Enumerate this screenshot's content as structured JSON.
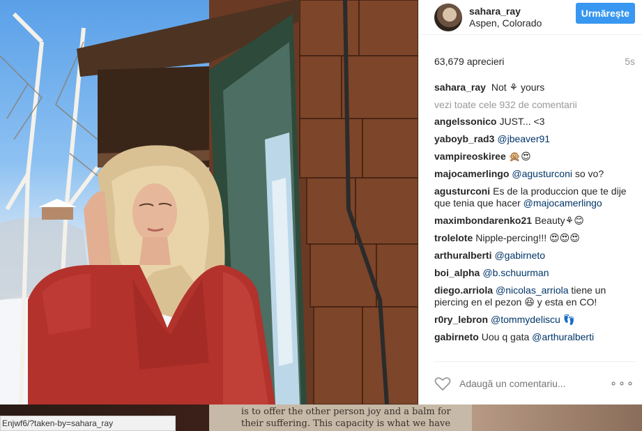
{
  "post": {
    "username": "sahara_ray",
    "location": "Aspen, Colorado",
    "follow_label": "Urmărește",
    "likes": "63,679 aprecieri",
    "time": "5s",
    "caption_user": "sahara_ray",
    "caption_text": "Not ⚘ yours",
    "view_all": "vezi toate cele 932 de comentarii",
    "comments": [
      {
        "user": "angelssonico",
        "text": "JUST... <3",
        "mention": ""
      },
      {
        "user": "yaboyb_rad3",
        "text": "",
        "mention": "@jbeaver91"
      },
      {
        "user": "vampireoskiree",
        "text": "🙊😍",
        "mention": ""
      },
      {
        "user": "majocamerlingo",
        "text": " so vo?",
        "mention": "@agusturconi"
      },
      {
        "user": "agusturconi",
        "text": "Es de la produccion que te dije que tenia que hacer ",
        "mention": "@majocamerlingo"
      },
      {
        "user": "maximbondarenko21",
        "text": "Beauty⚘😊",
        "mention": ""
      },
      {
        "user": "trolelote",
        "text": "Nipple-percing!!! 😍😍😍",
        "mention": ""
      },
      {
        "user": "arthuralberti",
        "text": "",
        "mention": "@gabirneto"
      },
      {
        "user": "boi_alpha",
        "text": "",
        "mention": "@b.schuurman"
      },
      {
        "user": "diego.arriola",
        "text": " tiene un piercing en el pezon 😆 y esta en CO!",
        "mention": "@nicolas_arriola"
      },
      {
        "user": "r0ry_lebron",
        "text": " 👣",
        "mention": "@tommydeliscu"
      },
      {
        "user": "gabirneto",
        "text": "Uou q gata ",
        "mention": "@arthuralberti"
      }
    ],
    "add_comment_placeholder": "Adaugă un comentariu...",
    "more_label": "∘∘∘"
  },
  "background": {
    "snippet_line1": "is to offer the other person joy and a balm for",
    "snippet_line2": "their suffering. This capacity is what we have"
  },
  "status_bar": {
    "url": "Enjwf6/?taken-by=sahara_ray"
  },
  "colors": {
    "follow_button": "#3897f0",
    "mention": "#003569",
    "dress": "#b3322c"
  }
}
